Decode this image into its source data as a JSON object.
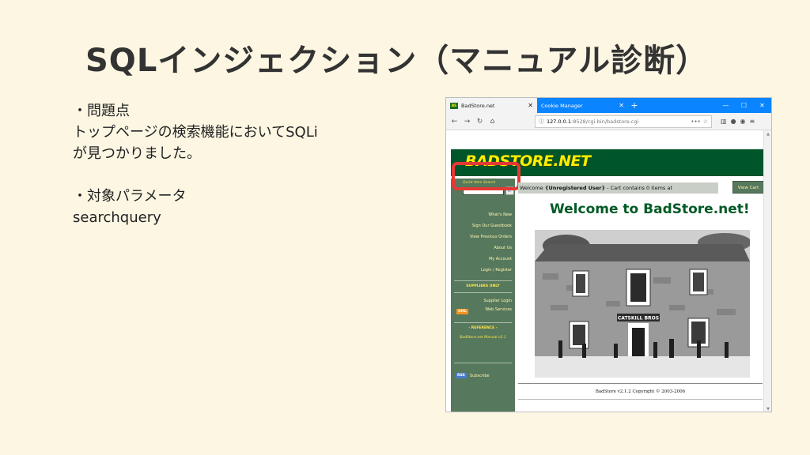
{
  "slide": {
    "title": "SQLインジェクション（マニュアル診断）",
    "bullet1_heading": "・問題点",
    "bullet1_line1": "トップページの検索機能においてSQLi",
    "bullet1_line2": "が見つかりました。",
    "bullet2_heading": "・対象パラメータ",
    "bullet2_value": "searchquery"
  },
  "browser": {
    "tabs": [
      {
        "label": "BadStore.net",
        "favicon": "BS"
      },
      {
        "label": "Cookie Manager"
      }
    ],
    "new_tab": "+",
    "window_controls": {
      "minimize": "—",
      "maximize": "☐",
      "close": "✕"
    },
    "nav": {
      "back": "←",
      "forward": "→",
      "reload": "↻",
      "home": "⌂"
    },
    "url_host": "127.0.0.1",
    "url_rest": ":8528/cgi-bin/badstore.cgi",
    "url_more": "•••",
    "url_star": "☆"
  },
  "site": {
    "logo": "BADSTORE.NET",
    "quick_search_label": "Quick Item Search",
    "quick_search_value": "",
    "welcome_prefix": "Welcome ",
    "welcome_user": "{Unregistered User}",
    "welcome_suffix": " - Cart contains 0 items at",
    "view_cart": "View Cart",
    "heading": "Welcome to BadStore.net!",
    "sidebar_links": [
      "What's New",
      "Sign Our Guestbook",
      "View Previous Orders",
      "About Us",
      "My Account",
      "Login / Register"
    ],
    "suppliers_heading": "SUPPLIERS ONLY",
    "supplier_login": "Supplier Login",
    "xml_badge": "XML",
    "web_services": "Web Services",
    "reference_heading": "- REFERENCE -",
    "manual_link": "BadStore.net Manual v2.1",
    "rss_badge": "RSS",
    "subscribe": "Subscribe",
    "photo_sign": "CATSKILL BROS",
    "footer": "BadStore v2.1.2 Copyright © 2003-2006"
  },
  "colors": {
    "slide_bg": "#fcf6e3",
    "site_green": "#00552a",
    "sidebar_green": "#56785c",
    "logo_yellow": "#ffee00",
    "highlight_red": "#e53935",
    "tabbar_blue": "#0a84ff"
  }
}
